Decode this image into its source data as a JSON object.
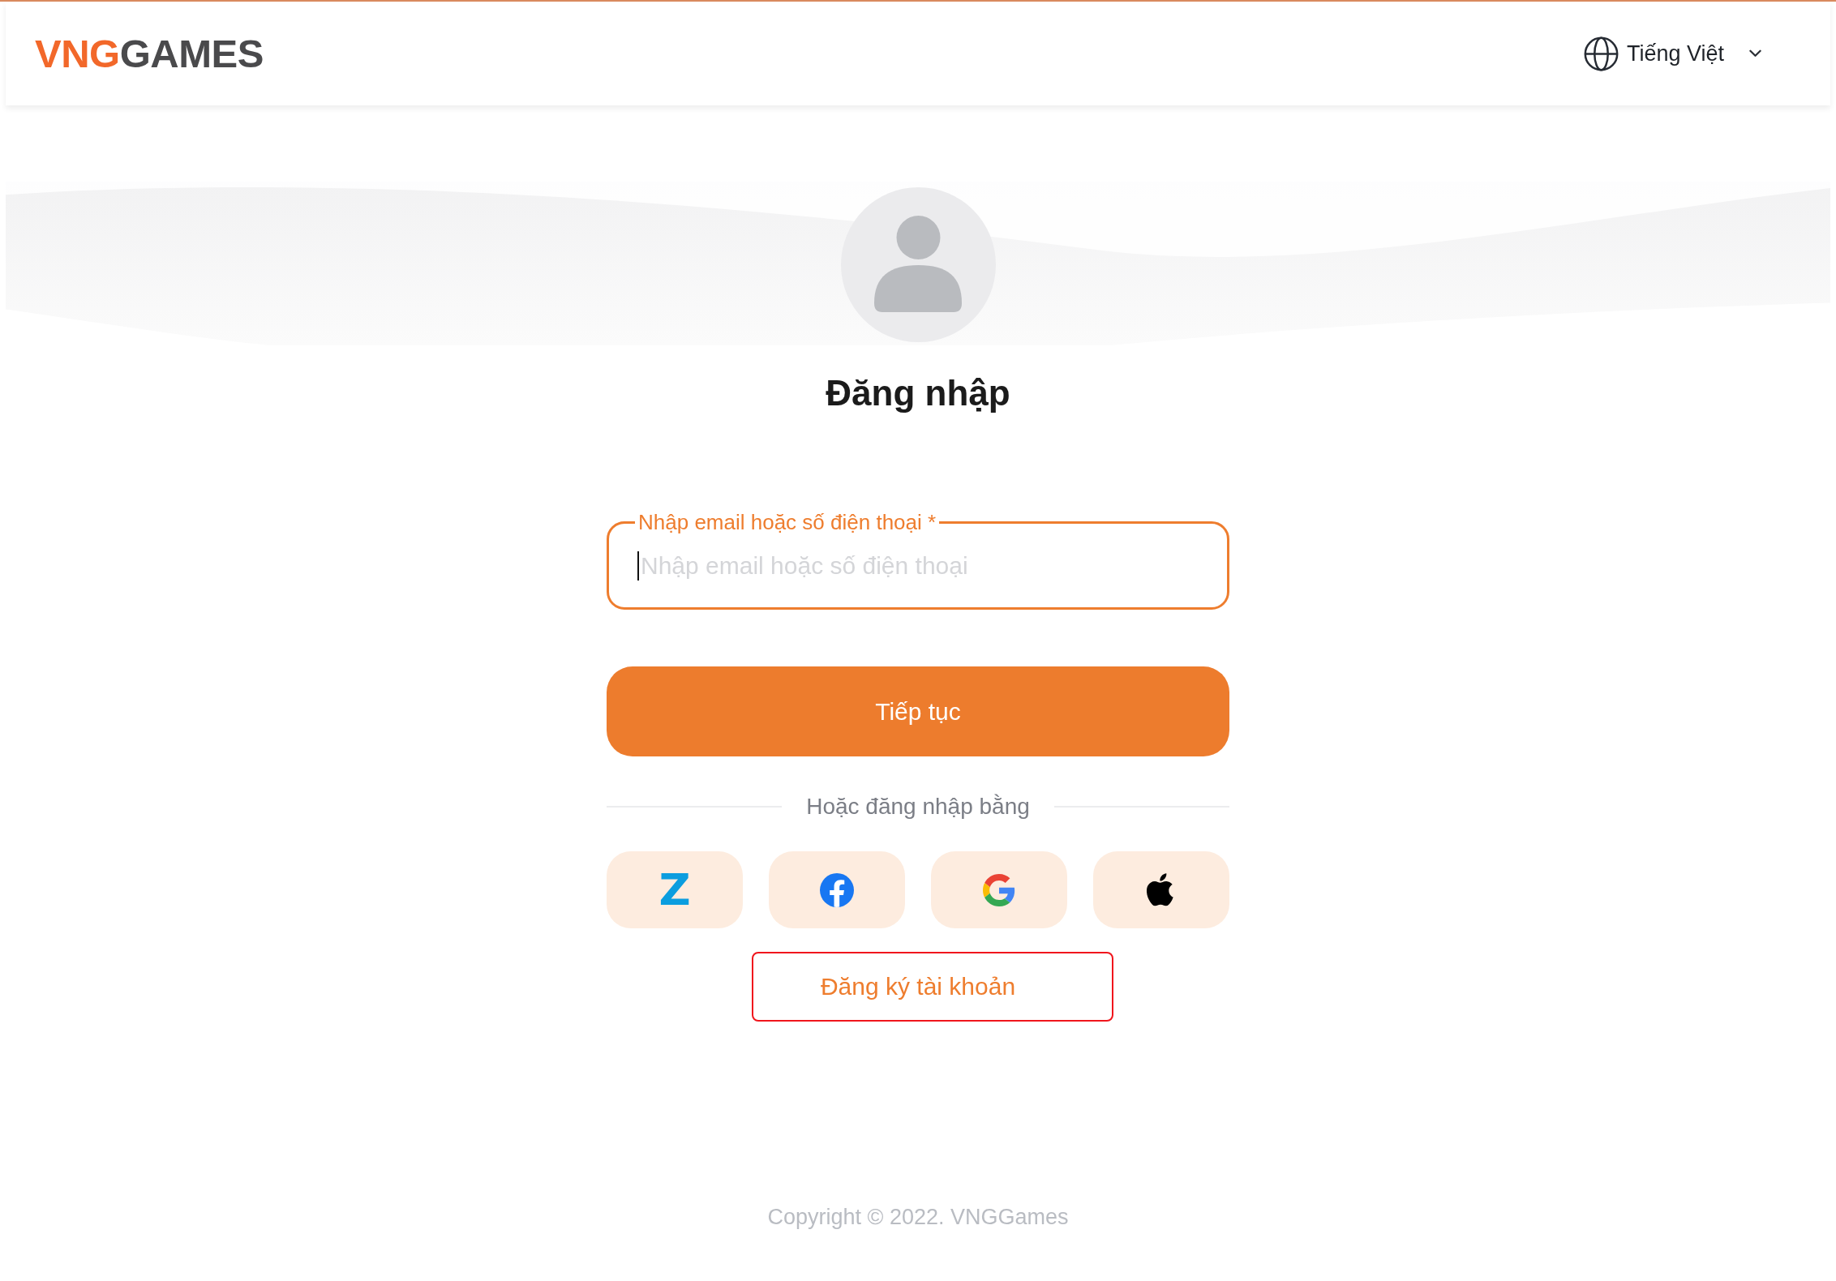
{
  "header": {
    "logo": {
      "accent": "VNG",
      "rest": "GAMES"
    },
    "language": {
      "label": "Tiếng Việt"
    }
  },
  "login": {
    "title": "Đăng nhập",
    "field": {
      "label": "Nhập email hoặc số điện thoại *",
      "placeholder": "Nhập email hoặc số điện thoại",
      "focused": true
    },
    "continue_button": "Tiếp tục",
    "divider": "Hoặc đăng nhập bằng",
    "social_buttons": [
      {
        "kind": "zalo",
        "glyph": "Z"
      },
      {
        "kind": "facebook"
      },
      {
        "kind": "google"
      },
      {
        "kind": "apple"
      }
    ],
    "register_button": "Đăng ký tài khoản"
  },
  "footer": {
    "copyright": "Copyright © 2022. VNGGames"
  }
}
